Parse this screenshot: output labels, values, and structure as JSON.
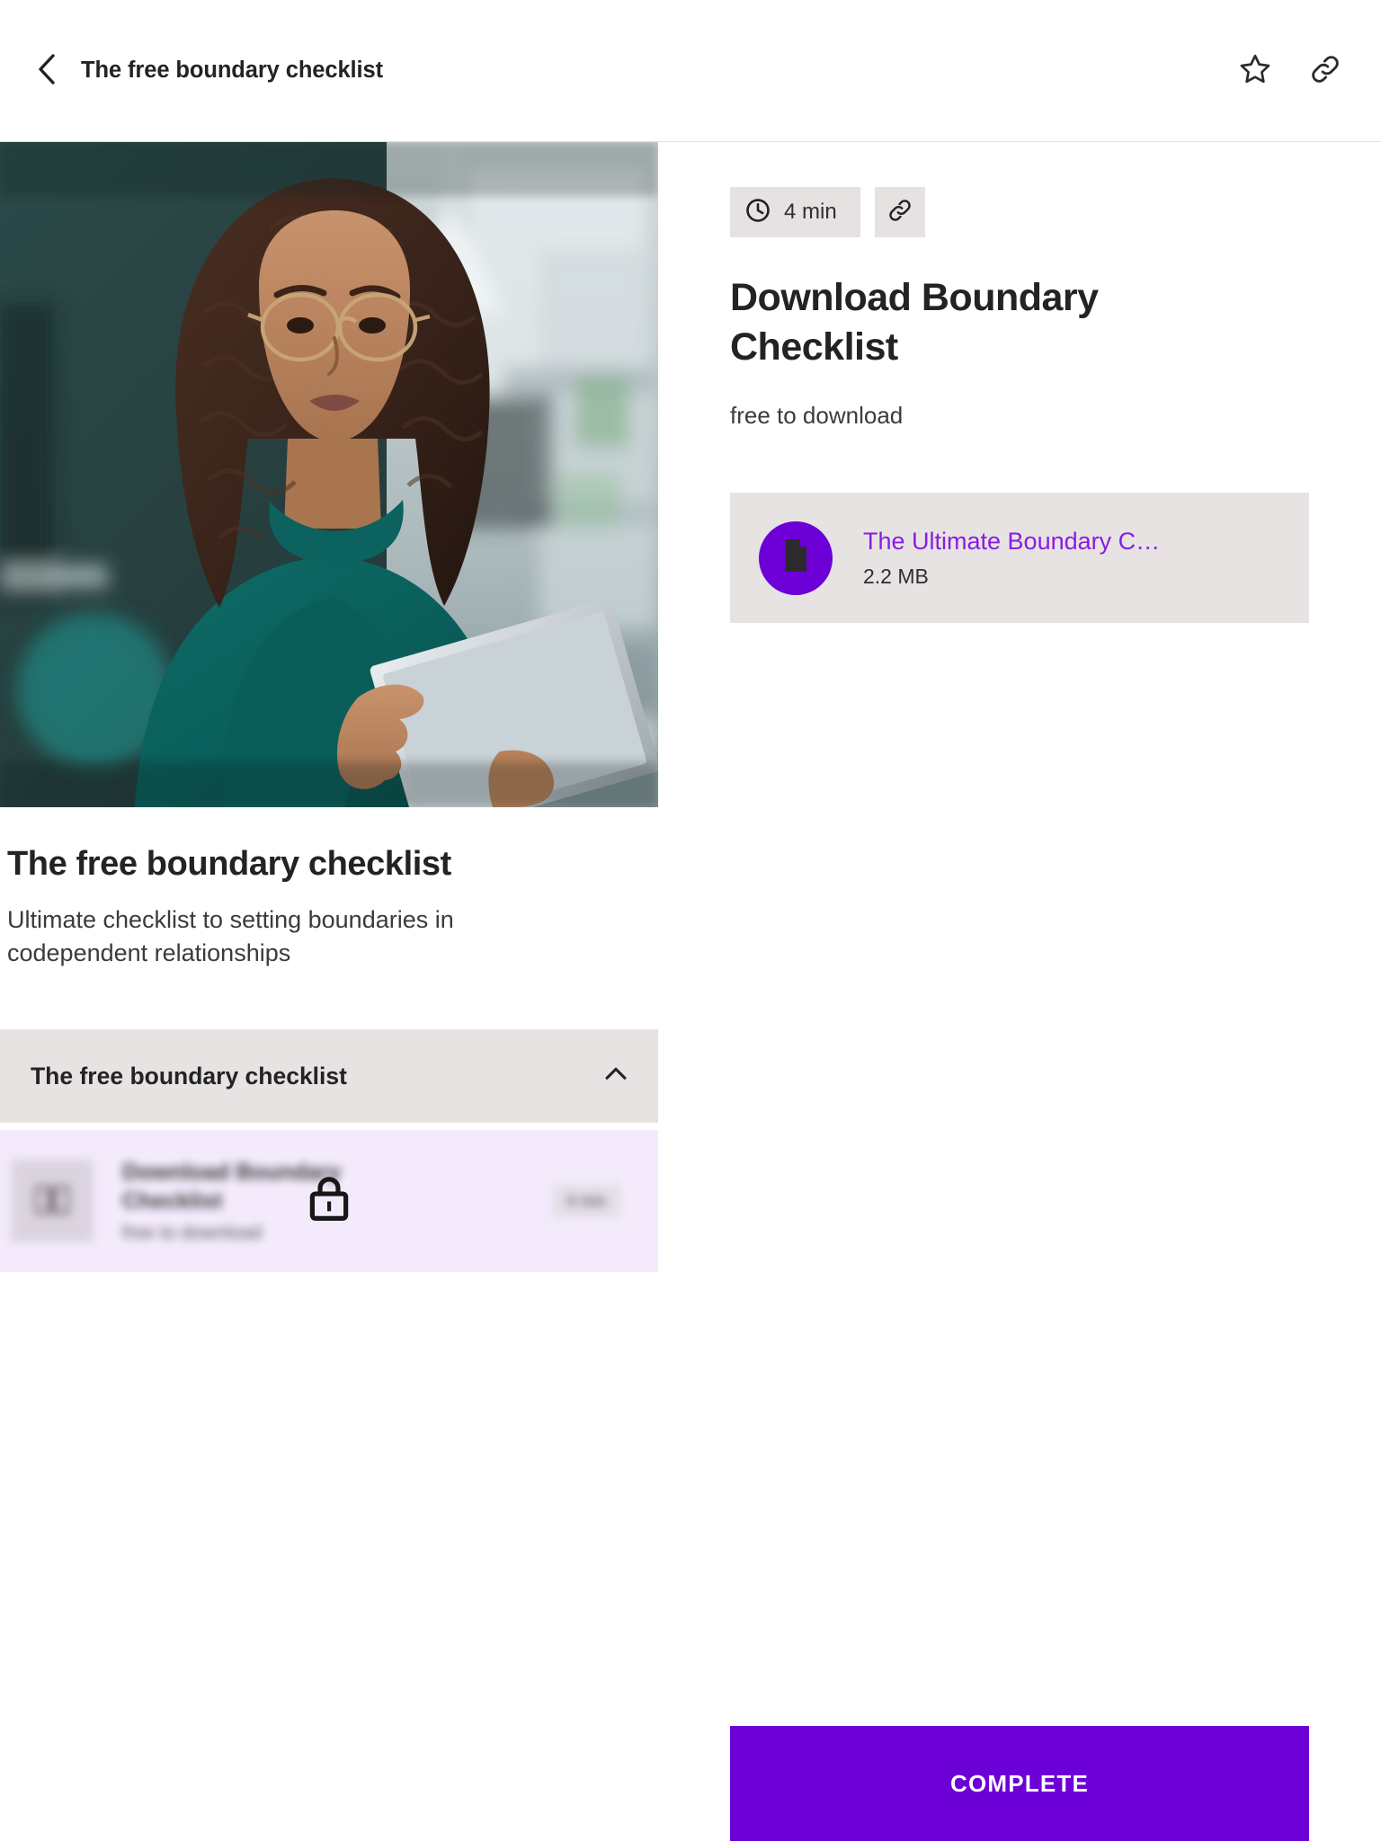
{
  "topbar": {
    "back_icon": "chevron-left-icon",
    "title": "The free boundary checklist",
    "favorite_icon": "star-outline-icon",
    "share_icon": "link-icon"
  },
  "left": {
    "hero_image_alt": "Woman in teal turtleneck using a tablet in an office",
    "lesson_title": "The free boundary checklist",
    "lesson_description": "Ultimate checklist to setting boundaries in codependent relationships",
    "accordion": {
      "label": "The free boundary checklist",
      "chevron_icon": "chevron-up-icon",
      "expanded": true,
      "items": [
        {
          "title": "Download Boundary Checklist",
          "subtitle": "free to download",
          "duration": "4 min",
          "thumb_icon": "book-icon",
          "locked": true,
          "lock_icon": "lock-icon"
        }
      ]
    }
  },
  "right": {
    "duration_icon": "clock-icon",
    "duration": "4 min",
    "share_icon": "link-icon",
    "title": "Download Boundary Checklist",
    "subtitle": "free to download",
    "attachment": {
      "file_icon": "document-icon",
      "name": "The Ultimate Boundary C…",
      "size": "2.2 MB"
    }
  },
  "footer": {
    "complete_label": "COMPLETE"
  },
  "colors": {
    "brand_purple": "#6C00D6",
    "link_purple": "#8A1CE0",
    "chip_grey": "#E6E2E2",
    "panel_grey": "#E7E3E3",
    "locked_lavender": "#F3EAFB",
    "text_dark": "#232323"
  }
}
